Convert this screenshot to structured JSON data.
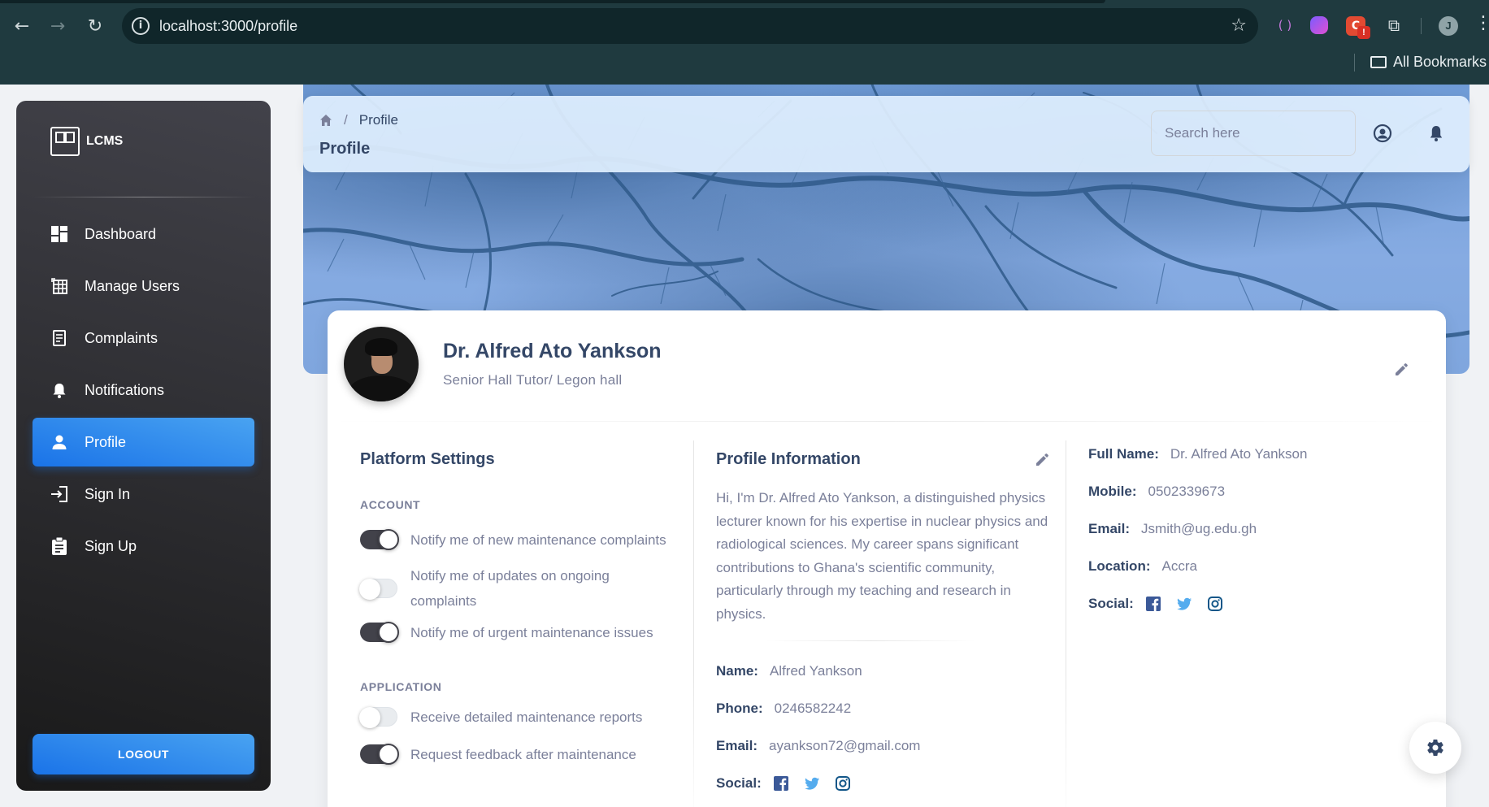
{
  "browser": {
    "url": "localhost:3000/profile",
    "bookmarks_label": "All Bookmarks",
    "profile_initial": "J"
  },
  "sidebar": {
    "brand": "LCMS",
    "items": [
      {
        "label": "Dashboard",
        "icon": "dashboard-icon",
        "active": false
      },
      {
        "label": "Manage Users",
        "icon": "table-icon",
        "active": false
      },
      {
        "label": "Complaints",
        "icon": "receipt-icon",
        "active": false
      },
      {
        "label": "Notifications",
        "icon": "bell-icon",
        "active": false
      },
      {
        "label": "Profile",
        "icon": "person-icon",
        "active": true
      },
      {
        "label": "Sign In",
        "icon": "login-icon",
        "active": false
      },
      {
        "label": "Sign Up",
        "icon": "assignment-icon",
        "active": false
      }
    ],
    "logout_label": "LOGOUT"
  },
  "topbar": {
    "breadcrumb_current": "Profile",
    "page_title": "Profile",
    "search_placeholder": "Search here"
  },
  "profile": {
    "name": "Dr. Alfred Ato Yankson",
    "title": "Senior Hall Tutor/ Legon hall"
  },
  "platform_settings": {
    "title": "Platform Settings",
    "groups": [
      {
        "label": "ACCOUNT",
        "settings": [
          {
            "label": "Notify me of new maintenance complaints",
            "enabled": true
          },
          {
            "label": "Notify me of updates on ongoing complaints",
            "enabled": false
          },
          {
            "label": "Notify me of urgent maintenance issues",
            "enabled": true
          }
        ]
      },
      {
        "label": "APPLICATION",
        "settings": [
          {
            "label": "Receive detailed maintenance reports",
            "enabled": false
          },
          {
            "label": "Request feedback after maintenance",
            "enabled": true
          }
        ]
      }
    ]
  },
  "profile_information": {
    "title": "Profile Information",
    "bio": "Hi, I'm Dr. Alfred Ato Yankson, a distinguished physics lecturer known for his expertise in nuclear physics and radiological sciences. My career spans significant contributions to Ghana's scientific community, particularly through my teaching and research in physics.",
    "fields": [
      {
        "key": "Name:",
        "value": "Alfred Yankson"
      },
      {
        "key": "Phone:",
        "value": "0246582242"
      },
      {
        "key": "Email:",
        "value": "ayankson72@gmail.com"
      }
    ],
    "social_label": "Social:"
  },
  "contact": {
    "fields": [
      {
        "key": "Full Name:",
        "value": "Dr. Alfred Ato Yankson"
      },
      {
        "key": "Mobile:",
        "value": "0502339673"
      },
      {
        "key": "Email:",
        "value": "Jsmith@ug.edu.gh"
      },
      {
        "key": "Location:",
        "value": "Accra"
      }
    ],
    "social_label": "Social:"
  },
  "colors": {
    "facebook": "#3b5998",
    "twitter": "#55acee",
    "instagram": "#125688",
    "accent": "#1a73e8"
  }
}
